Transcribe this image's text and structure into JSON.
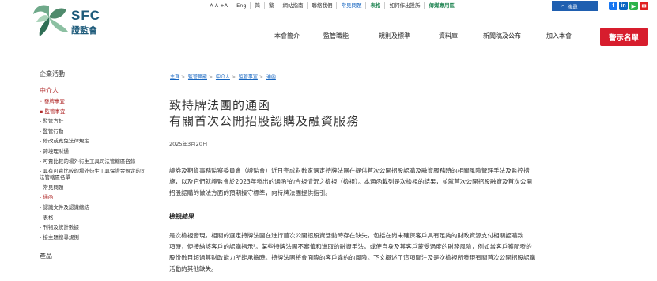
{
  "logo": {
    "abbr": "SFC",
    "name": "證監會"
  },
  "utility_bar": [
    "-A  A  +A",
    "Eng",
    "简",
    "繁",
    "網站指南",
    "聯絡我們",
    "常見問題",
    "表格",
    "如何作出投訴",
    "傳媒專用區"
  ],
  "search_label": "搜尋",
  "social": [
    "f",
    "in",
    "▶",
    "✉"
  ],
  "main_nav": [
    "本會簡介",
    "監管職能",
    "規則及標準",
    "資料庫",
    "新聞稿及公布",
    "加入本會"
  ],
  "alert_button": "警示名單",
  "sidebar": {
    "section": "企業活動",
    "current": "中介人",
    "items": [
      "• 發牌事宜",
      "▪ 監管事宜",
      "- 監管方針",
      "- 監管行動",
      "- 修改或寬免法律規定",
      "- 跨境理財通",
      "- 可責比較的場外衍生工具司法管轄區名錄",
      "- 具有可責比較的場外衍生工具保證金規定的司法管轄區名單",
      "- 常見問題",
      "- 通函",
      "- 認識文件及認識總結",
      "- 表格",
      "- 刊物及統計數據",
      "- 接主題搜尋規例"
    ],
    "active_index": 9,
    "bottom": "產品"
  },
  "breadcrumb": [
    "主頁",
    "監管職能",
    "中介人",
    "監管事宜",
    "通函"
  ],
  "article": {
    "title_line1": "致持牌法團的通函",
    "title_line2": "有關首次公開招股認購及融資服務",
    "date": "2025年3月20日",
    "para1_l1": "證券及期貨事務監察委員會（證監會）近日完成對數家選定持牌法團在提供首次公開招股認購及融資服務時的相關風險管理手法及監控措",
    "para1_l2": "施，以及它們就證監會於2023年發出的通函¹的合規情況之檢視（檢視）。本通函載列是次檢視的結果，並就首次公開招股融資及首次公開",
    "para1_l3": "招股認購的做法方面的預期操守標準，向持牌法團提供指引。",
    "section_title": "檢視結果",
    "para2_l1": "是次檢視發現，相關的選定持牌法團在進行首次公開招股資活動時存在缺失，包括在尚未確保客戶具有足夠的財政資源支付相關認購款",
    "para2_l2": "項時，便接納該客戶的認購指示²。某些持牌法團不審慎和進取的融資手法，或使自身及其客戶蒙受過度的財務風險，例如當客戶獲配發的",
    "para2_l3": "股份數目超過其財政能力所能承擔時。持牌法團將會面臨的客戶違約的風險。下文概述了這項關注及是次檢視所發現有關首次公開招股認購",
    "para2_l4": "活動的其他缺失。"
  },
  "colors": {
    "brand": "#1d5a7a",
    "alert": "#d71d2d",
    "link": "#1565c0",
    "active": "#b02a2a"
  }
}
